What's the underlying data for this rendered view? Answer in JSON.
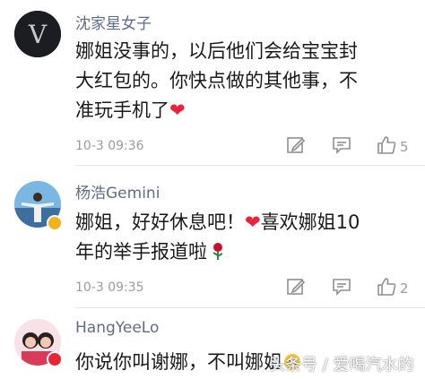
{
  "colors": {
    "username": "#5e6c8a",
    "text": "#1a1a1a",
    "meta": "#9b9b9b",
    "heart": "#e8233a"
  },
  "comments": [
    {
      "username": "沈家星女子",
      "avatar_letter": "V",
      "lines": [
        "娜姐没事的，以后他们会给宝宝封",
        "大红包的。你快点做的其他事，不",
        "准玩手机了"
      ],
      "emoji": "heart",
      "time": "10-3 09:36",
      "likes": "5"
    },
    {
      "username": "杨浩Gemini",
      "lines": [
        "娜姐，好好休息吧！",
        "喜欢娜姐10",
        "年的举手报道啦"
      ],
      "emoji": "heart, rose",
      "time": "10-3 09:35",
      "likes": "2"
    },
    {
      "username": "HangYeeLo",
      "lines": [
        "你说你叫谢娜，不叫娜姐"
      ],
      "emoji": "grin"
    }
  ],
  "icons": [
    "edit-icon",
    "reply-icon",
    "like-icon"
  ],
  "watermark": "头条号 / 爱喝汽水的"
}
